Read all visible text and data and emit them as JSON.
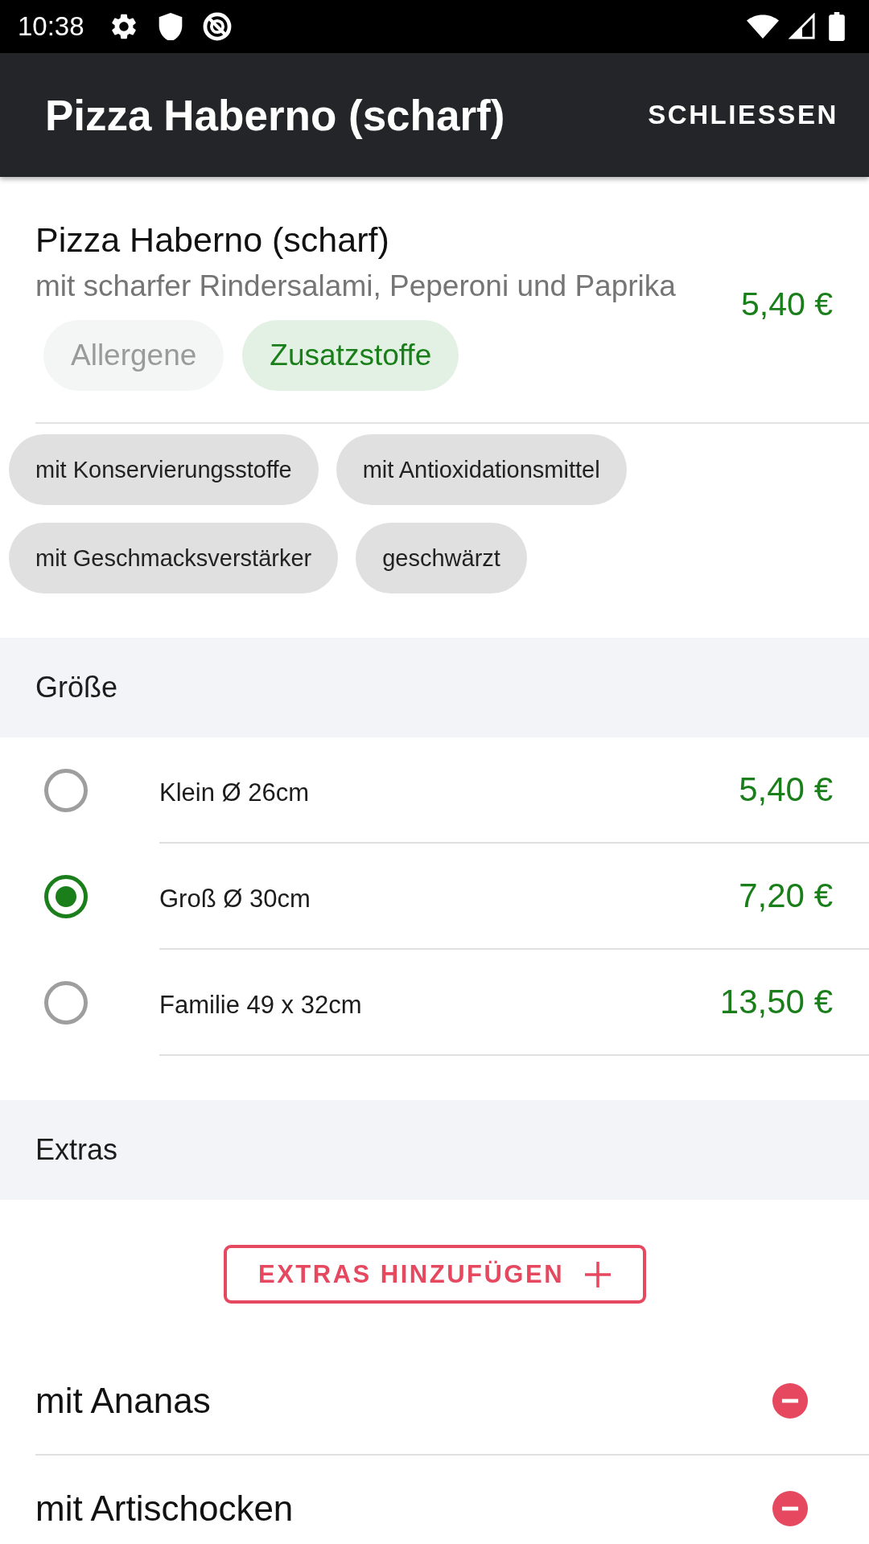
{
  "status_bar": {
    "time": "10:38"
  },
  "app_bar": {
    "title": "Pizza Haberno (scharf)",
    "action": "SCHLIESSEN"
  },
  "product": {
    "name": "Pizza Haberno (scharf)",
    "description": "mit scharfer Rindersalami, Peperoni und Paprika",
    "price": "5,40 €",
    "tabs": [
      {
        "label": "Allergene",
        "selected": false
      },
      {
        "label": "Zusatzstoffe",
        "selected": true
      }
    ],
    "chips": [
      "mit Konservierungsstoffe",
      "mit Antioxidationsmittel",
      "mit Geschmacksverstärker",
      "geschwärzt"
    ]
  },
  "sections": [
    {
      "kind": "radio",
      "title": "Größe",
      "options": [
        {
          "label": "Klein Ø 26cm",
          "price": "5,40 €",
          "selected": false
        },
        {
          "label": "Groß Ø 30cm",
          "price": "7,20 €",
          "selected": true
        },
        {
          "label": "Familie 49 x 32cm",
          "price": "13,50 €",
          "selected": false
        }
      ]
    },
    {
      "kind": "extras",
      "title": "Extras",
      "button": "EXTRAS HINZUFÜGEN",
      "items": [
        {
          "label": "mit Ananas"
        },
        {
          "label": "mit Artischocken"
        }
      ]
    }
  ]
}
